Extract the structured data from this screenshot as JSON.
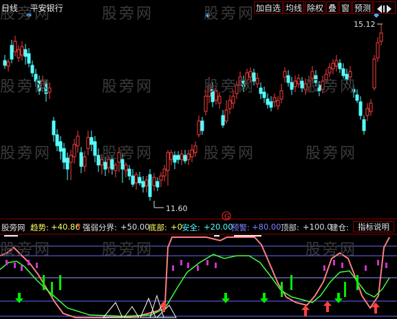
{
  "header": {
    "period": "日线",
    "stock_name": "平安银行",
    "buttons": [
      "加自选",
      "均线",
      "除权",
      "叠",
      "窗",
      "预测"
    ],
    "nav_icon": "arrow-left-right-icon"
  },
  "price_labels": {
    "high": "15.12",
    "low": "11.60"
  },
  "indicator": {
    "name": "股旁网",
    "trend_label": "趋势:",
    "trend_value": "+40.86",
    "trend_arrow": "↑",
    "strength_label": "强弱分界:",
    "strength_value": "+50.00",
    "bottom_label": "底部:",
    "bottom_value": "+0",
    "safe_label": "安全:",
    "safe_value": "+20.00",
    "warn_label": "预警:",
    "warn_value": "+80.00",
    "top_label": "顶部:",
    "top_value": "+100.0",
    "position_label": "建仓:",
    "help_button": "指标说明"
  },
  "markers": {
    "g_label": "G"
  },
  "watermark": "股旁网",
  "colors": {
    "background": "#000000",
    "up_candle": "#ff4040",
    "down_candle": "#54ffff",
    "accent_border": "#8a0000",
    "trend_line": "#ff8080",
    "signal_line": "#40ff40",
    "buy_arrow": "#ff4040",
    "sell_arrow": "#00ee00",
    "guide_line": "#6a6aff"
  }
}
